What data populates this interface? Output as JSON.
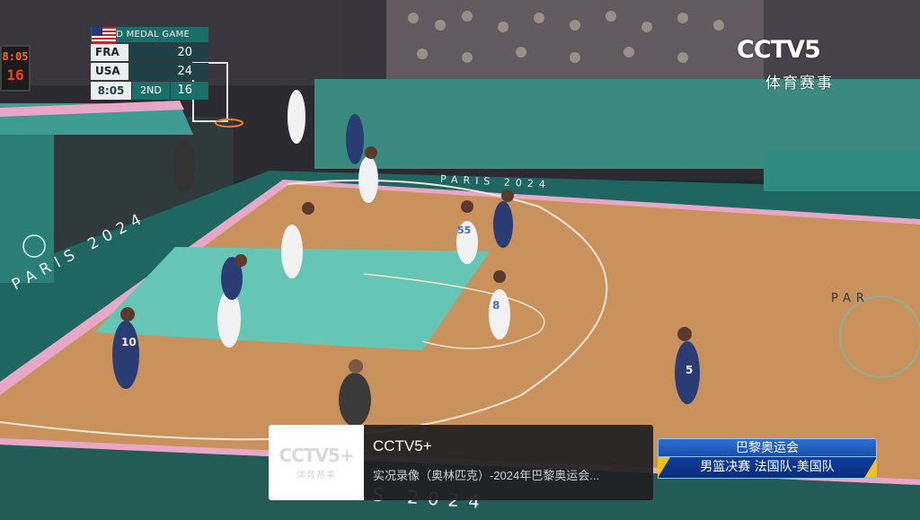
{
  "scoreboard": {
    "title": "GOLD MEDAL GAME",
    "team1": {
      "name": "FRA",
      "score": "20"
    },
    "team2": {
      "name": "USA",
      "score": "24"
    },
    "game_clock": "8:05",
    "period": "2ND",
    "shot_clock": "16"
  },
  "arena_clock": {
    "time": "8:05",
    "shot": "16"
  },
  "channel_logo": {
    "name": "CCTV5",
    "subtitle": "体育赛事"
  },
  "court_branding": {
    "text": "PARIS 2024"
  },
  "info_banner": {
    "logo_line1": "CCTV5+",
    "logo_line2": "体育赛事",
    "channel": "CCTV5+",
    "program": "实况录像（奥林匹克）-2024年巴黎奥运会..."
  },
  "event_banner": {
    "line1": "巴黎奥运会",
    "line2": "男篮决赛 法国队-美国队"
  },
  "players": [
    {
      "team": "FRA",
      "number": "55"
    },
    {
      "team": "FRA",
      "number": "8"
    },
    {
      "team": "USA",
      "number": "10"
    },
    {
      "team": "USA",
      "number": "5"
    }
  ],
  "colors": {
    "court_wood": "#c9925c",
    "paint": "#66c6b5",
    "border_pink": "#e7a8c8",
    "teal_border": "#1f6660",
    "scoreboard_teal": "#1a6f6b"
  }
}
